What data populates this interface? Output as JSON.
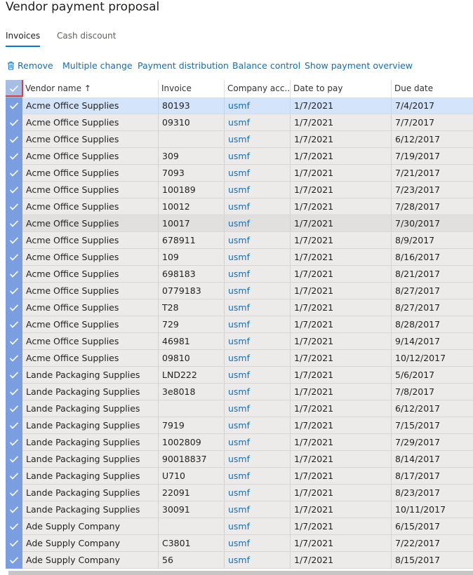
{
  "page": {
    "title": "Vendor payment proposal"
  },
  "tabs": [
    {
      "label": "Invoices"
    },
    {
      "label": "Cash discount"
    }
  ],
  "toolbar": {
    "remove": "Remove",
    "multiple_change": "Multiple change",
    "payment_distribution": "Payment distribution",
    "balance_control": "Balance control",
    "show_payment_overview": "Show payment overview"
  },
  "grid": {
    "columns": [
      {
        "label": "Vendor name ↑"
      },
      {
        "label": "Invoice"
      },
      {
        "label": "Company acc..."
      },
      {
        "label": "Date to pay"
      },
      {
        "label": "Due date"
      }
    ],
    "rows": [
      {
        "vendor": "Acme Office Supplies",
        "invoice": "80193",
        "company": "usmf",
        "date_to_pay": "1/7/2021",
        "due": "7/4/2017"
      },
      {
        "vendor": "Acme Office Supplies",
        "invoice": "09310",
        "company": "usmf",
        "date_to_pay": "1/7/2021",
        "due": "7/7/2017"
      },
      {
        "vendor": "Acme Office Supplies",
        "invoice": "",
        "company": "usmf",
        "date_to_pay": "1/7/2021",
        "due": "6/12/2017"
      },
      {
        "vendor": "Acme Office Supplies",
        "invoice": "309",
        "company": "usmf",
        "date_to_pay": "1/7/2021",
        "due": "7/19/2017"
      },
      {
        "vendor": "Acme Office Supplies",
        "invoice": "7093",
        "company": "usmf",
        "date_to_pay": "1/7/2021",
        "due": "7/21/2017"
      },
      {
        "vendor": "Acme Office Supplies",
        "invoice": "100189",
        "company": "usmf",
        "date_to_pay": "1/7/2021",
        "due": "7/23/2017"
      },
      {
        "vendor": "Acme Office Supplies",
        "invoice": "10012",
        "company": "usmf",
        "date_to_pay": "1/7/2021",
        "due": "7/28/2017"
      },
      {
        "vendor": "Acme Office Supplies",
        "invoice": "10017",
        "company": "usmf",
        "date_to_pay": "1/7/2021",
        "due": "7/30/2017"
      },
      {
        "vendor": "Acme Office Supplies",
        "invoice": "678911",
        "company": "usmf",
        "date_to_pay": "1/7/2021",
        "due": "8/9/2017"
      },
      {
        "vendor": "Acme Office Supplies",
        "invoice": "109",
        "company": "usmf",
        "date_to_pay": "1/7/2021",
        "due": "8/16/2017"
      },
      {
        "vendor": "Acme Office Supplies",
        "invoice": "698183",
        "company": "usmf",
        "date_to_pay": "1/7/2021",
        "due": "8/21/2017"
      },
      {
        "vendor": "Acme Office Supplies",
        "invoice": "0779183",
        "company": "usmf",
        "date_to_pay": "1/7/2021",
        "due": "8/27/2017"
      },
      {
        "vendor": "Acme Office Supplies",
        "invoice": "T28",
        "company": "usmf",
        "date_to_pay": "1/7/2021",
        "due": "8/27/2017"
      },
      {
        "vendor": "Acme Office Supplies",
        "invoice": "729",
        "company": "usmf",
        "date_to_pay": "1/7/2021",
        "due": "8/28/2017"
      },
      {
        "vendor": "Acme Office Supplies",
        "invoice": "46981",
        "company": "usmf",
        "date_to_pay": "1/7/2021",
        "due": "9/14/2017"
      },
      {
        "vendor": "Acme Office Supplies",
        "invoice": "09810",
        "company": "usmf",
        "date_to_pay": "1/7/2021",
        "due": "10/12/2017"
      },
      {
        "vendor": "Lande Packaging Supplies",
        "invoice": "LND222",
        "company": "usmf",
        "date_to_pay": "1/7/2021",
        "due": "5/6/2017"
      },
      {
        "vendor": "Lande Packaging Supplies",
        "invoice": "3e8018",
        "company": "usmf",
        "date_to_pay": "1/7/2021",
        "due": "7/8/2017"
      },
      {
        "vendor": "Lande Packaging Supplies",
        "invoice": "",
        "company": "usmf",
        "date_to_pay": "1/7/2021",
        "due": "6/12/2017"
      },
      {
        "vendor": "Lande Packaging Supplies",
        "invoice": "7919",
        "company": "usmf",
        "date_to_pay": "1/7/2021",
        "due": "7/15/2017"
      },
      {
        "vendor": "Lande Packaging Supplies",
        "invoice": "1002809",
        "company": "usmf",
        "date_to_pay": "1/7/2021",
        "due": "7/29/2017"
      },
      {
        "vendor": "Lande Packaging Supplies",
        "invoice": "90018837",
        "company": "usmf",
        "date_to_pay": "1/7/2021",
        "due": "8/14/2017"
      },
      {
        "vendor": "Lande Packaging Supplies",
        "invoice": "U710",
        "company": "usmf",
        "date_to_pay": "1/7/2021",
        "due": "8/17/2017"
      },
      {
        "vendor": "Lande Packaging Supplies",
        "invoice": "22091",
        "company": "usmf",
        "date_to_pay": "1/7/2021",
        "due": "8/23/2017"
      },
      {
        "vendor": "Lande Packaging Supplies",
        "invoice": "30091",
        "company": "usmf",
        "date_to_pay": "1/7/2021",
        "due": "10/11/2017"
      },
      {
        "vendor": "Ade Supply Company",
        "invoice": "",
        "company": "usmf",
        "date_to_pay": "1/7/2021",
        "due": "6/15/2017"
      },
      {
        "vendor": "Ade Supply Company",
        "invoice": "C3801",
        "company": "usmf",
        "date_to_pay": "1/7/2021",
        "due": "7/22/2017"
      },
      {
        "vendor": "Ade Supply Company",
        "invoice": "56",
        "company": "usmf",
        "date_to_pay": "1/7/2021",
        "due": "8/15/2017"
      }
    ]
  },
  "colors": {
    "accent": "#0078d4",
    "link": "#106ebe",
    "selected_row": "#d4e4fb",
    "row_bg": "#ecebea",
    "check_col": "#7a9ee0",
    "highlight_box": "#e03a3a"
  },
  "icons": {
    "remove": "trash-icon",
    "sort": "sort-ascending-icon",
    "check": "checkmark-icon"
  }
}
